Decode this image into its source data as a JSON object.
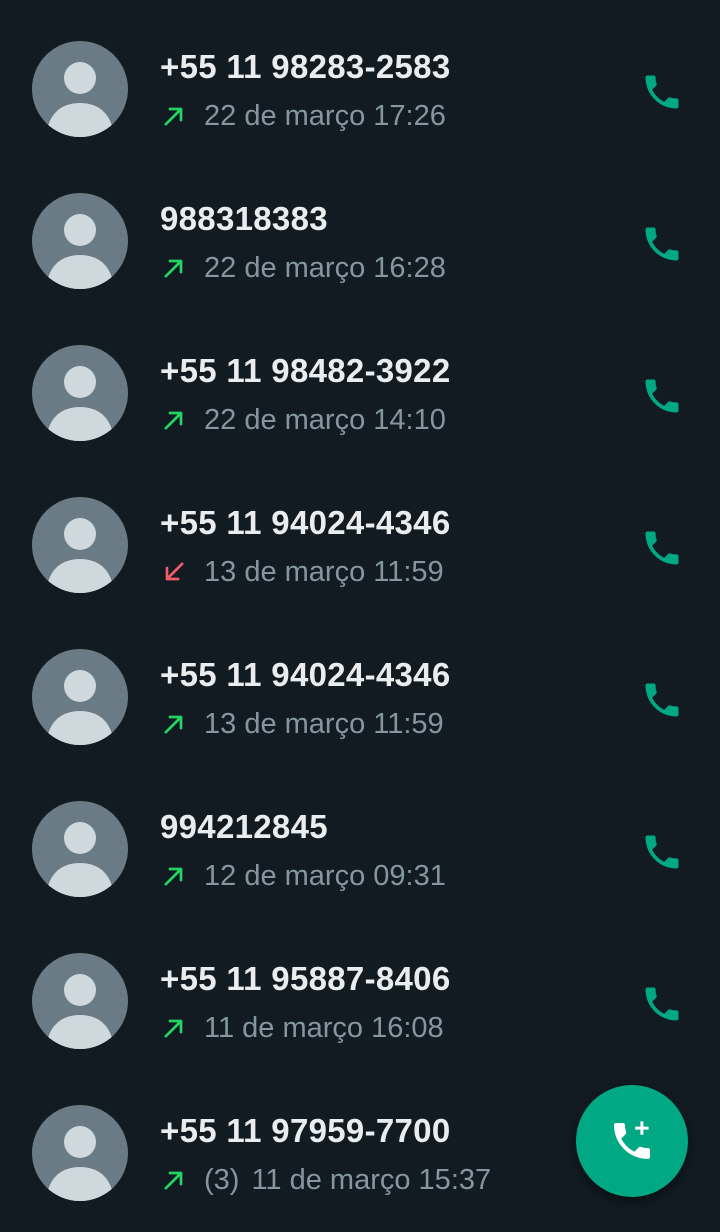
{
  "colors": {
    "background": "#111b21",
    "accent": "#00a884",
    "outgoing_arrow": "#25d366",
    "missed_arrow": "#f15c6d",
    "primary_text": "#e9edef",
    "secondary_text": "#8696a0",
    "avatar_bg": "#6a7b86",
    "avatar_fg": "#cfd8dc"
  },
  "calls": [
    {
      "name": "+55 11 98283-2583",
      "direction": "outgoing",
      "direction_icon": "outgoing-call-arrow-icon",
      "count": "",
      "time": "22 de março 17:26"
    },
    {
      "name": "988318383",
      "direction": "outgoing",
      "direction_icon": "outgoing-call-arrow-icon",
      "count": "",
      "time": "22 de março 16:28"
    },
    {
      "name": "+55 11 98482-3922",
      "direction": "outgoing",
      "direction_icon": "outgoing-call-arrow-icon",
      "count": "",
      "time": "22 de março 14:10"
    },
    {
      "name": "+55 11 94024-4346",
      "direction": "missed",
      "direction_icon": "missed-call-arrow-icon",
      "count": "",
      "time": "13 de março 11:59"
    },
    {
      "name": "+55 11 94024-4346",
      "direction": "outgoing",
      "direction_icon": "outgoing-call-arrow-icon",
      "count": "",
      "time": "13 de março 11:59"
    },
    {
      "name": "994212845",
      "direction": "outgoing",
      "direction_icon": "outgoing-call-arrow-icon",
      "count": "",
      "time": "12 de março 09:31"
    },
    {
      "name": "+55 11 95887-8406",
      "direction": "outgoing",
      "direction_icon": "outgoing-call-arrow-icon",
      "count": "",
      "time": "11 de março 16:08"
    },
    {
      "name": "+55 11 97959-7700",
      "direction": "outgoing",
      "direction_icon": "outgoing-call-arrow-icon",
      "count": "(3)",
      "time": "11 de março 15:37"
    }
  ],
  "icons": {
    "avatar": "default-avatar-icon",
    "call_button": "phone-icon",
    "fab": "new-call-icon"
  }
}
